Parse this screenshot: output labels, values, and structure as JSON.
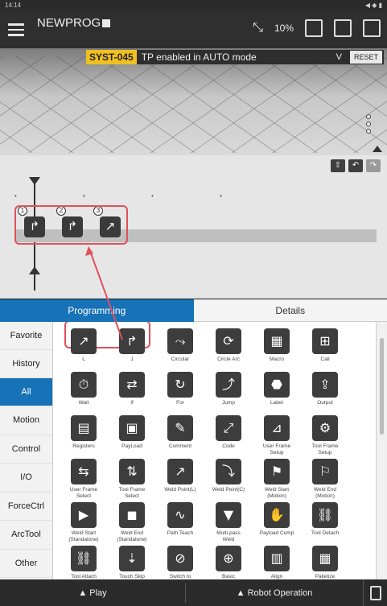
{
  "statusbar": {
    "time": "14:14",
    "right": "◀ ◆ ▮"
  },
  "topbar": {
    "program_name": "NEWPROG",
    "override": "10%"
  },
  "alarm": {
    "code": "SYST-045",
    "message": "TP enabled in AUTO mode",
    "expand": "V",
    "reset_label": "RESET"
  },
  "view": {
    "handle": "• • • • •"
  },
  "timeline": {
    "buttons": [
      "⇧",
      "↶",
      "↷"
    ],
    "commands": [
      {
        "num": "1",
        "glyph": "↱"
      },
      {
        "num": "2",
        "glyph": "↱"
      },
      {
        "num": "3",
        "glyph": "↗"
      }
    ]
  },
  "tabs": {
    "programming": "Programming",
    "details": "Details"
  },
  "sidebar": {
    "items": [
      "Favorite",
      "History",
      "All",
      "Motion",
      "Control",
      "I/O",
      "ForceCtrl",
      "ArcTool",
      "Other"
    ]
  },
  "commands": [
    {
      "label": "L",
      "glyph": "↗"
    },
    {
      "label": "J",
      "glyph": "↱"
    },
    {
      "label": "Circular",
      "glyph": "⤳"
    },
    {
      "label": "Circle Arc",
      "glyph": "⟳"
    },
    {
      "label": "Macro",
      "glyph": "▦"
    },
    {
      "label": "Call",
      "glyph": "⊞"
    },
    {
      "label": "Wait",
      "glyph": "⏱"
    },
    {
      "label": "If",
      "glyph": "⇄"
    },
    {
      "label": "For",
      "glyph": "↻"
    },
    {
      "label": "Jump",
      "glyph": "⤴"
    },
    {
      "label": "Label",
      "glyph": "⬣"
    },
    {
      "label": "Output",
      "glyph": "⇪"
    },
    {
      "label": "Registers",
      "glyph": "▤"
    },
    {
      "label": "PayLoad",
      "glyph": "▣"
    },
    {
      "label": "Comment",
      "glyph": "✎"
    },
    {
      "label": "Code",
      "glyph": "⤢"
    },
    {
      "label": "User Frame\nSetup",
      "glyph": "⊿"
    },
    {
      "label": "Tool Frame\nSetup",
      "glyph": "⚙"
    },
    {
      "label": "User Frame\nSelect",
      "glyph": "⇆"
    },
    {
      "label": "Tool Frame\nSelect",
      "glyph": "⇅"
    },
    {
      "label": "Weld Point(L)",
      "glyph": "↗"
    },
    {
      "label": "Weld Point(C)",
      "glyph": "⤵"
    },
    {
      "label": "Weld Start\n(Motion)",
      "glyph": "⚑"
    },
    {
      "label": "Weld End\n(Motion)",
      "glyph": "⚐"
    },
    {
      "label": "Weld Start\n(Standalone)",
      "glyph": "▶"
    },
    {
      "label": "Weld End\n(Standalone)",
      "glyph": "◼"
    },
    {
      "label": "Path Teach",
      "glyph": "∿"
    },
    {
      "label": "Multi-pass\nWeld",
      "glyph": "▼"
    },
    {
      "label": "Payload Comp",
      "glyph": "✋"
    },
    {
      "label": "Tool Detach",
      "glyph": "⛓"
    },
    {
      "label": "Tool Attach",
      "glyph": "⛓"
    },
    {
      "label": "Touch Skip",
      "glyph": "⇣"
    },
    {
      "label": "Switch to",
      "glyph": "⊘"
    },
    {
      "label": "Basic",
      "glyph": "⊕"
    },
    {
      "label": "Align",
      "glyph": "▥"
    },
    {
      "label": "Palletize",
      "glyph": "▦"
    }
  ],
  "bottombar": {
    "play": "▲ Play",
    "robot": "▲ Robot Operation"
  }
}
